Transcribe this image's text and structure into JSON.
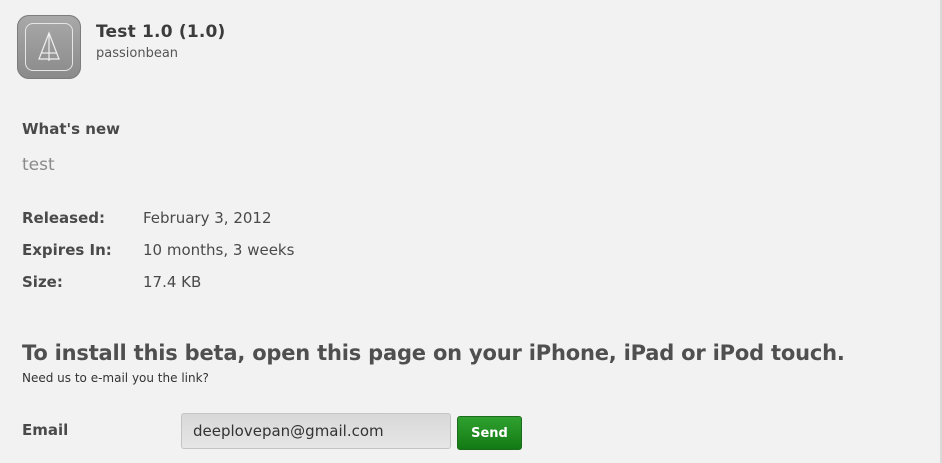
{
  "app": {
    "title": "Test 1.0 (1.0)",
    "author": "passionbean",
    "icon": "app-icon"
  },
  "whats_new": {
    "heading": "What's new",
    "text": "test"
  },
  "details": [
    {
      "label": "Released:",
      "value": "February 3, 2012"
    },
    {
      "label": "Expires In:",
      "value": "10 months, 3 weeks"
    },
    {
      "label": "Size:",
      "value": "17.4 KB"
    }
  ],
  "install": {
    "heading": "To install this beta, open this page on your iPhone, iPad or iPod touch.",
    "subtext": "Need us to e-mail you the link?",
    "email_label": "Email",
    "email_value": "deeplovepan@gmail.com",
    "send_label": "Send"
  },
  "colors": {
    "background": "#f2f2f2",
    "text": "#4a4a4a",
    "send_button": "#1f8c1f"
  }
}
